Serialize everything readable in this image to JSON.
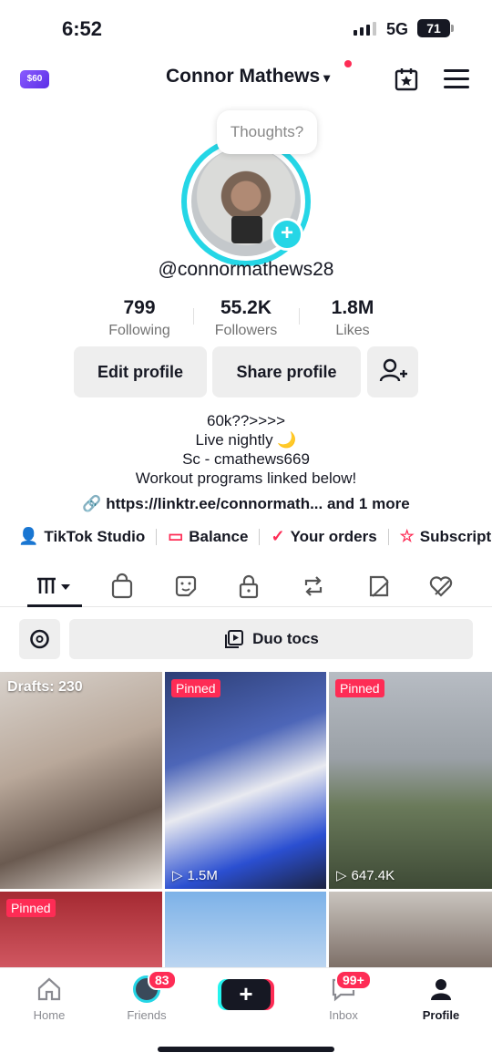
{
  "status_bar": {
    "time": "6:52",
    "network": "5G",
    "battery": "71"
  },
  "header": {
    "coin_label": "$60",
    "username": "Connor Mathews",
    "chevron": "⌄"
  },
  "profile": {
    "bubble": "Thoughts?",
    "handle": "@connormathews28",
    "stats": [
      {
        "value": "799",
        "label": "Following"
      },
      {
        "value": "55.2K",
        "label": "Followers"
      },
      {
        "value": "1.8M",
        "label": "Likes"
      }
    ],
    "buttons": {
      "edit": "Edit profile",
      "share": "Share profile"
    },
    "bio": [
      "60k??>>>>",
      "Live nightly 🌙",
      "Sc - cmathews669",
      "Workout programs linked below!"
    ],
    "link": "https://linktr.ee/connormath... and 1 more"
  },
  "quick_links": [
    {
      "label": "TikTok Studio",
      "icon": "person-star-icon"
    },
    {
      "label": "Balance",
      "icon": "wallet-icon"
    },
    {
      "label": "Your orders",
      "icon": "order-icon"
    },
    {
      "label": "Subscripti",
      "icon": "star-icon"
    }
  ],
  "duo": {
    "label": "Duo tocs"
  },
  "grid": {
    "drafts": "Drafts: 230",
    "pinned": "Pinned",
    "views": [
      "1.5M",
      "647.4K"
    ]
  },
  "nav": {
    "home": "Home",
    "friends": "Friends",
    "friends_badge": "83",
    "inbox": "Inbox",
    "inbox_badge": "99+",
    "profile": "Profile",
    "create": "+"
  },
  "colors": {
    "accent": "#fe2c55",
    "ring": "#25d6e6",
    "text": "#161823"
  }
}
